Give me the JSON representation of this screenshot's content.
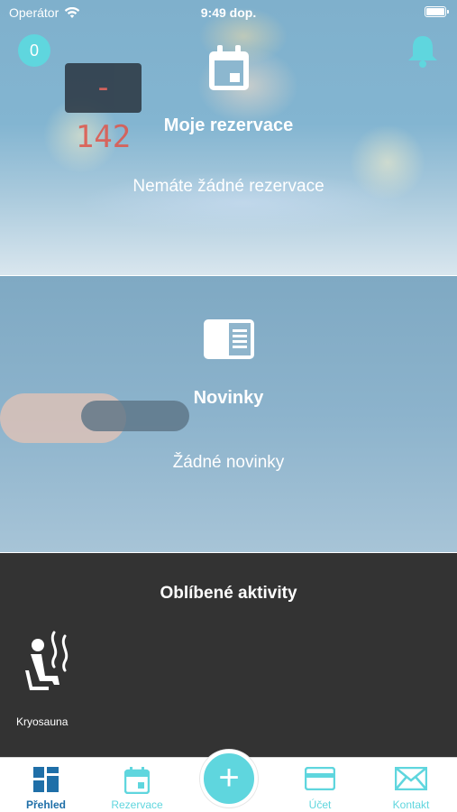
{
  "status_bar": {
    "carrier": "Operátor",
    "time": "9:49 dop."
  },
  "header": {
    "badge_count": "0"
  },
  "reservations": {
    "title": "Moje rezervace",
    "empty_text": "Nemáte žádné rezervace",
    "display_value": "- 142"
  },
  "news": {
    "title": "Novinky",
    "empty_text": "Žádné novinky"
  },
  "favorites": {
    "title": "Oblíbené aktivity",
    "items": [
      {
        "label": "Kryosauna",
        "icon": "sauna-icon"
      }
    ]
  },
  "tabs": [
    {
      "label": "Přehled",
      "icon": "grid-icon",
      "active": true
    },
    {
      "label": "Rezervace",
      "icon": "calendar-icon",
      "active": false
    },
    {
      "label": "Účet",
      "icon": "card-icon",
      "active": false
    },
    {
      "label": "Kontakt",
      "icon": "envelope-icon",
      "active": false
    }
  ],
  "fab_label": "+",
  "colors": {
    "accent": "#5fd6de",
    "active_tab": "#1f6fa8",
    "favorites_bg": "#333333"
  }
}
